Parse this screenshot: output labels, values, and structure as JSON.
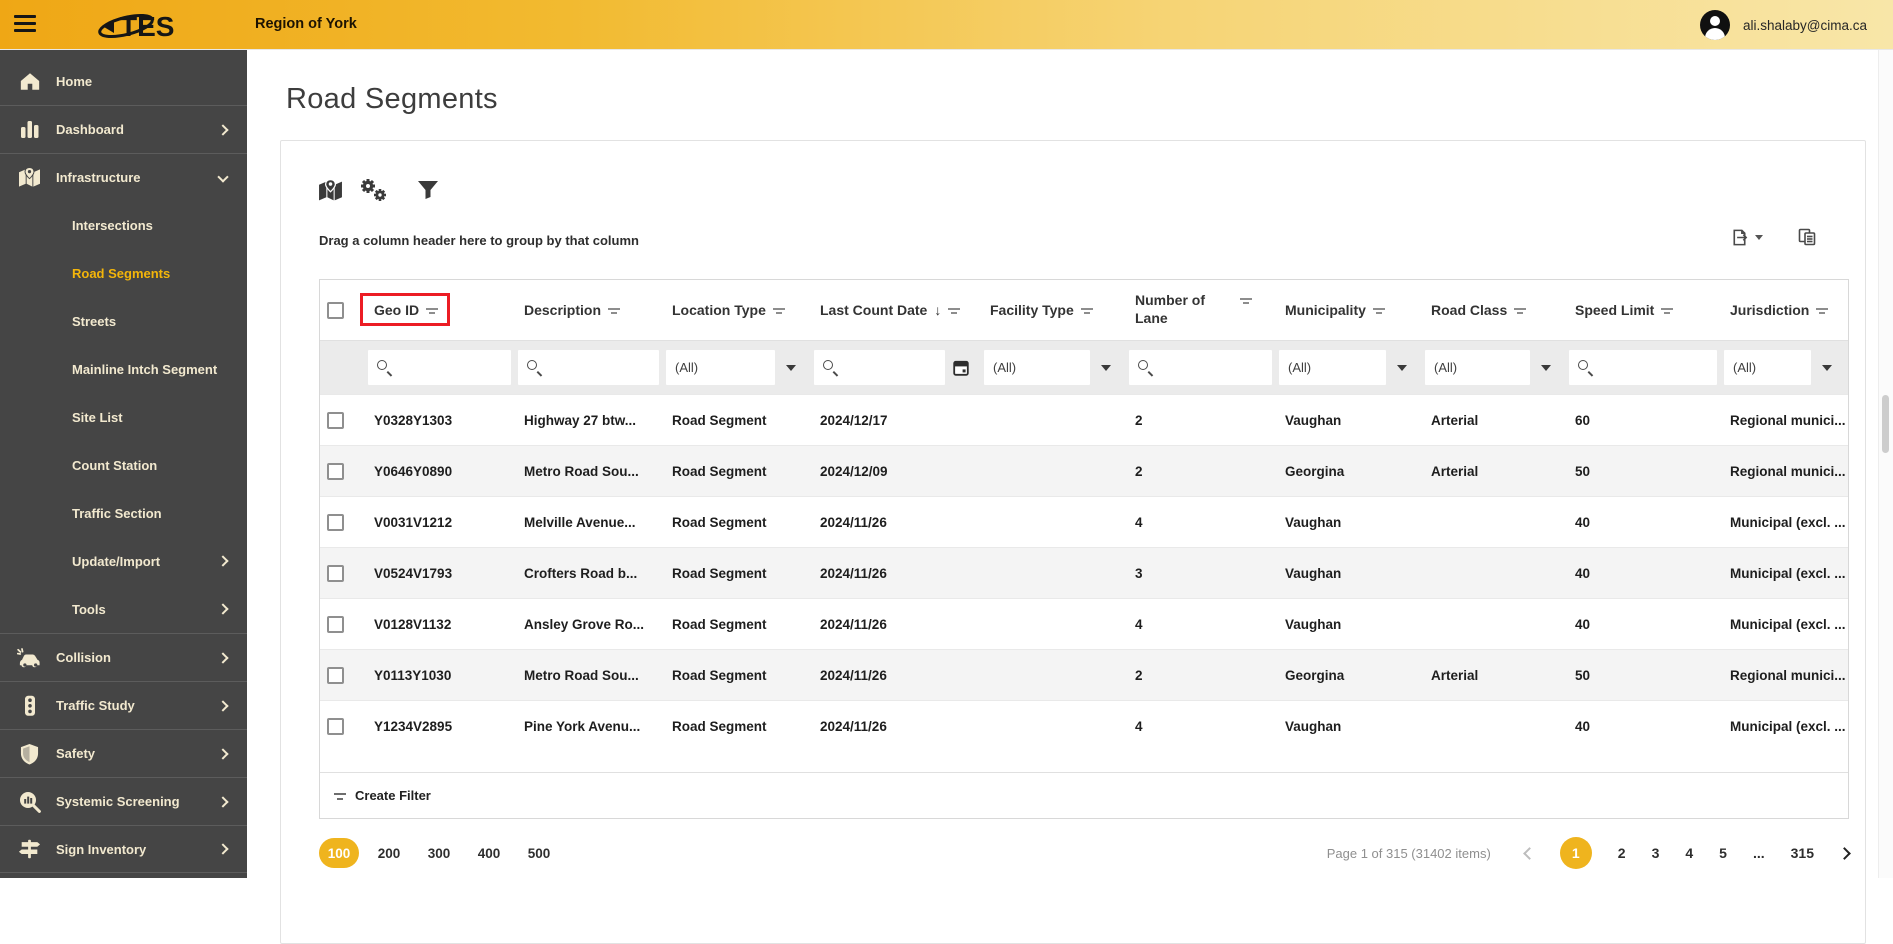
{
  "topbar": {
    "logo_text": "TES",
    "region_title": "Region of York",
    "user_email": "ali.shalaby@cima.ca"
  },
  "page": {
    "title": "Road Segments",
    "drag_hint": "Drag a column header here to group by that column",
    "create_filter_label": "Create Filter"
  },
  "sidebar": {
    "items": [
      {
        "label": "Home",
        "icon": "home-icon",
        "chevron": "none"
      },
      {
        "label": "Dashboard",
        "icon": "dashboard-icon",
        "chevron": "right"
      },
      {
        "label": "Infrastructure",
        "icon": "infrastructure-map-icon",
        "chevron": "down",
        "children": [
          {
            "label": "Intersections"
          },
          {
            "label": "Road Segments",
            "selected": true
          },
          {
            "label": "Streets"
          },
          {
            "label": "Mainline Intch Segment"
          },
          {
            "label": "Site List"
          },
          {
            "label": "Count Station"
          },
          {
            "label": "Traffic Section"
          },
          {
            "label": "Update/Import",
            "chevron": "right"
          },
          {
            "label": "Tools",
            "chevron": "right"
          }
        ]
      },
      {
        "label": "Collision",
        "icon": "collision-icon",
        "chevron": "right"
      },
      {
        "label": "Traffic Study",
        "icon": "traffic-light-icon",
        "chevron": "right"
      },
      {
        "label": "Safety",
        "icon": "shield-icon",
        "chevron": "right"
      },
      {
        "label": "Systemic Screening",
        "icon": "screening-magnifier-icon",
        "chevron": "right"
      },
      {
        "label": "Sign Inventory",
        "icon": "signpost-icon",
        "chevron": "right"
      }
    ]
  },
  "toolbar": {
    "icons": [
      "map-icon",
      "settings-gears-icon",
      "filter-funnel-icon"
    ]
  },
  "export": {
    "icons": [
      "export-icon",
      "column-chooser-icon"
    ]
  },
  "grid": {
    "columns": [
      {
        "label": "Geo ID",
        "filter": "search",
        "highlighted": true
      },
      {
        "label": "Description",
        "filter": "search"
      },
      {
        "label": "Location Type",
        "filter": "select",
        "filter_value": "(All)"
      },
      {
        "label": "Last Count Date",
        "filter": "date",
        "sort": "desc",
        "sort_glyph": "↓"
      },
      {
        "label": "Facility Type",
        "filter": "select",
        "filter_value": "(All)"
      },
      {
        "label": "Number of Lane",
        "filter": "search"
      },
      {
        "label": "Municipality",
        "filter": "select",
        "filter_value": "(All)"
      },
      {
        "label": "Road Class",
        "filter": "select",
        "filter_value": "(All)"
      },
      {
        "label": "Speed Limit",
        "filter": "search"
      },
      {
        "label": "Jurisdiction",
        "filter": "select",
        "filter_value": "(All)"
      }
    ],
    "rows": [
      {
        "geo_id": "Y0328Y1303",
        "description": "Highway 27 btw...",
        "location_type": "Road Segment",
        "last_count_date": "2024/12/17",
        "facility_type": "",
        "number_of_lane": "2",
        "municipality": "Vaughan",
        "road_class": "Arterial",
        "speed_limit": "60",
        "jurisdiction": "Regional munici..."
      },
      {
        "geo_id": "Y0646Y0890",
        "description": "Metro Road Sou...",
        "location_type": "Road Segment",
        "last_count_date": "2024/12/09",
        "facility_type": "",
        "number_of_lane": "2",
        "municipality": "Georgina",
        "road_class": "Arterial",
        "speed_limit": "50",
        "jurisdiction": "Regional munici..."
      },
      {
        "geo_id": "V0031V1212",
        "description": "Melville Avenue...",
        "location_type": "Road Segment",
        "last_count_date": "2024/11/26",
        "facility_type": "",
        "number_of_lane": "4",
        "municipality": "Vaughan",
        "road_class": "",
        "speed_limit": "40",
        "jurisdiction": "Municipal (excl. ..."
      },
      {
        "geo_id": "V0524V1793",
        "description": "Crofters Road b...",
        "location_type": "Road Segment",
        "last_count_date": "2024/11/26",
        "facility_type": "",
        "number_of_lane": "3",
        "municipality": "Vaughan",
        "road_class": "",
        "speed_limit": "40",
        "jurisdiction": "Municipal (excl. ..."
      },
      {
        "geo_id": "V0128V1132",
        "description": "Ansley Grove Ro...",
        "location_type": "Road Segment",
        "last_count_date": "2024/11/26",
        "facility_type": "",
        "number_of_lane": "4",
        "municipality": "Vaughan",
        "road_class": "",
        "speed_limit": "40",
        "jurisdiction": "Municipal (excl. ..."
      },
      {
        "geo_id": "Y0113Y1030",
        "description": "Metro Road Sou...",
        "location_type": "Road Segment",
        "last_count_date": "2024/11/26",
        "facility_type": "",
        "number_of_lane": "2",
        "municipality": "Georgina",
        "road_class": "Arterial",
        "speed_limit": "50",
        "jurisdiction": "Regional munici..."
      },
      {
        "geo_id": "Y1234V2895",
        "description": "Pine York Avenu...",
        "location_type": "Road Segment",
        "last_count_date": "2024/11/26",
        "facility_type": "",
        "number_of_lane": "4",
        "municipality": "Vaughan",
        "road_class": "",
        "speed_limit": "40",
        "jurisdiction": "Municipal (excl. ..."
      }
    ]
  },
  "pager": {
    "page_sizes": [
      {
        "label": "100",
        "selected": true
      },
      {
        "label": "200"
      },
      {
        "label": "300"
      },
      {
        "label": "400"
      },
      {
        "label": "500"
      }
    ],
    "info": "Page 1 of 315 (31402 items)",
    "pages": [
      {
        "label": "1",
        "selected": true
      },
      {
        "label": "2"
      },
      {
        "label": "3"
      },
      {
        "label": "4"
      },
      {
        "label": "5"
      },
      {
        "label": "..."
      },
      {
        "label": "315"
      }
    ]
  },
  "colors": {
    "topbar_gradient_start": "#EFA715",
    "topbar_gradient_end": "#F8E6A8",
    "sidebar_bg": "#454545",
    "sidebar_text": "#F2E9CF",
    "accent_gold": "#EFB41E",
    "selected_item_gold": "#F3B50A",
    "highlight_red": "#EC1C24"
  }
}
